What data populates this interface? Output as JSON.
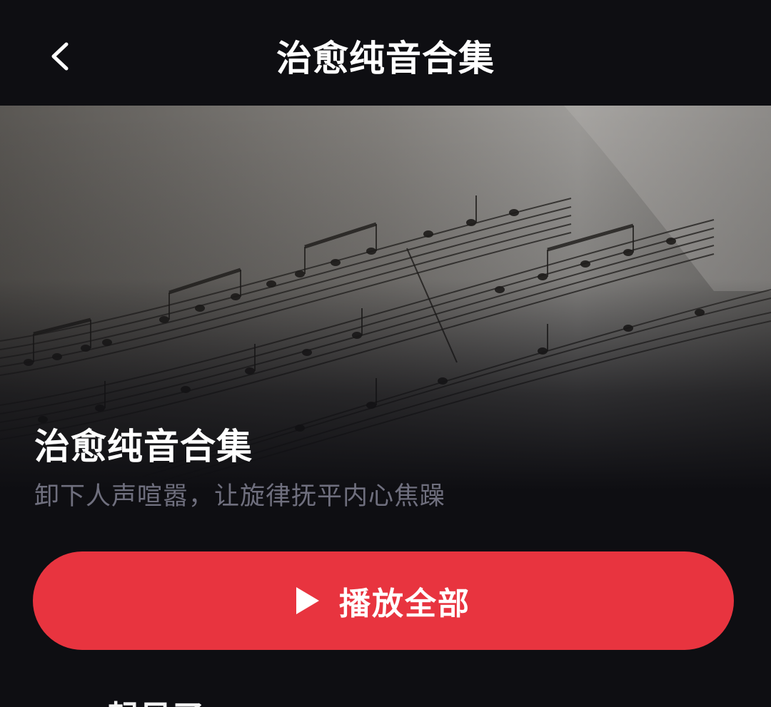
{
  "header": {
    "title": "治愈纯音合集",
    "back_icon": "chevron-left-icon"
  },
  "playlist": {
    "cover_image": "sheet-music-photo",
    "name": "治愈纯音合集",
    "description": "卸下人声喧嚣，让旋律抚平内心焦躁"
  },
  "actions": {
    "play_all_label": "播放全部",
    "play_all_icon": "play-icon",
    "play_all_color": "#e8343f"
  },
  "songs": [
    {
      "title": "起风了"
    }
  ],
  "colors": {
    "background": "#0e0e12",
    "title_text": "#ffffff",
    "description_text": "#6f6f7e",
    "accent": "#e8343f"
  }
}
